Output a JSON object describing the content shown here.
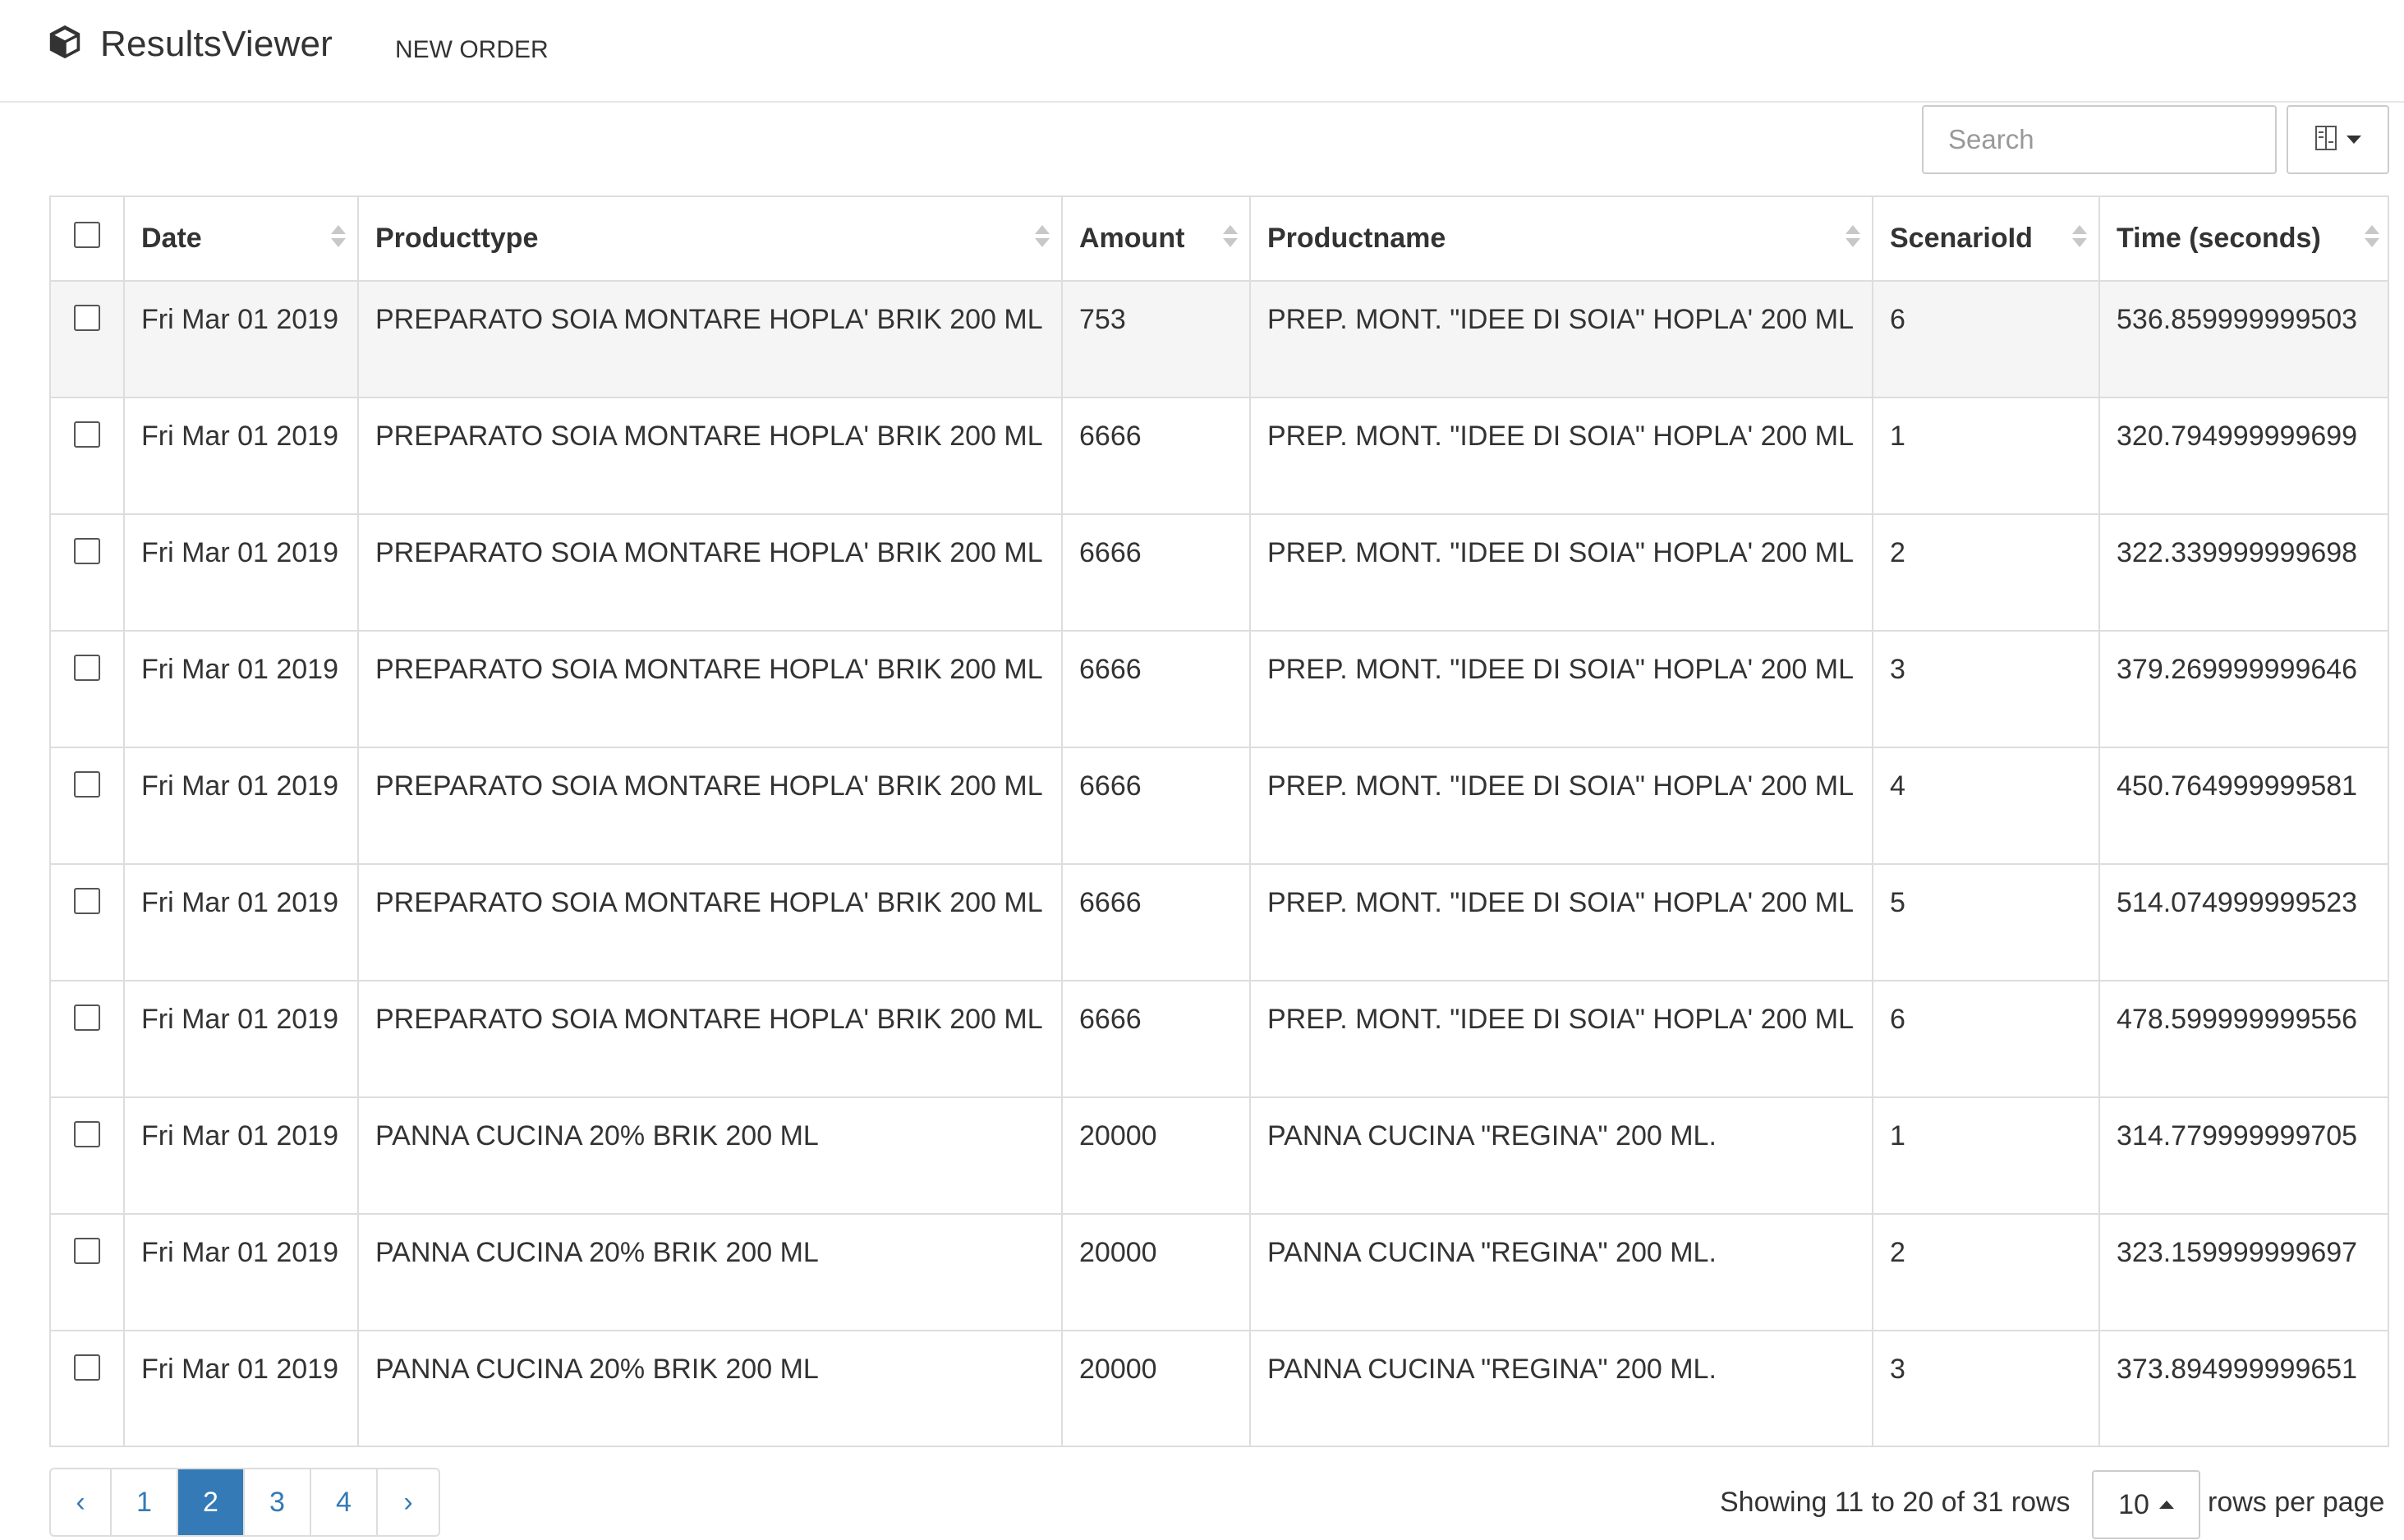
{
  "app": {
    "title": "ResultsViewer",
    "logo_icon": "cube-icon"
  },
  "nav": {
    "new_order": "NEW ORDER"
  },
  "toolbar": {
    "search_placeholder": "Search",
    "columns_icon": "columns-toggle-icon"
  },
  "table": {
    "columns": [
      "Date",
      "Producttype",
      "Amount",
      "Productname",
      "ScenarioId",
      "Time (seconds)"
    ],
    "rows": [
      {
        "date": "Fri Mar 01 2019",
        "producttype": "PREPARATO SOIA MONTARE HOPLA' BRIK 200 ML",
        "amount": "753",
        "productname": "PREP. MONT. \"IDEE DI SOIA\" HOPLA' 200 ML",
        "scenario": "6",
        "time": "536.859999999503"
      },
      {
        "date": "Fri Mar 01 2019",
        "producttype": "PREPARATO SOIA MONTARE HOPLA' BRIK 200 ML",
        "amount": "6666",
        "productname": "PREP. MONT. \"IDEE DI SOIA\" HOPLA' 200 ML",
        "scenario": "1",
        "time": "320.794999999699"
      },
      {
        "date": "Fri Mar 01 2019",
        "producttype": "PREPARATO SOIA MONTARE HOPLA' BRIK 200 ML",
        "amount": "6666",
        "productname": "PREP. MONT. \"IDEE DI SOIA\" HOPLA' 200 ML",
        "scenario": "2",
        "time": "322.339999999698"
      },
      {
        "date": "Fri Mar 01 2019",
        "producttype": "PREPARATO SOIA MONTARE HOPLA' BRIK 200 ML",
        "amount": "6666",
        "productname": "PREP. MONT. \"IDEE DI SOIA\" HOPLA' 200 ML",
        "scenario": "3",
        "time": "379.269999999646"
      },
      {
        "date": "Fri Mar 01 2019",
        "producttype": "PREPARATO SOIA MONTARE HOPLA' BRIK 200 ML",
        "amount": "6666",
        "productname": "PREP. MONT. \"IDEE DI SOIA\" HOPLA' 200 ML",
        "scenario": "4",
        "time": "450.764999999581"
      },
      {
        "date": "Fri Mar 01 2019",
        "producttype": "PREPARATO SOIA MONTARE HOPLA' BRIK 200 ML",
        "amount": "6666",
        "productname": "PREP. MONT. \"IDEE DI SOIA\" HOPLA' 200 ML",
        "scenario": "5",
        "time": "514.074999999523"
      },
      {
        "date": "Fri Mar 01 2019",
        "producttype": "PREPARATO SOIA MONTARE HOPLA' BRIK 200 ML",
        "amount": "6666",
        "productname": "PREP. MONT. \"IDEE DI SOIA\" HOPLA' 200 ML",
        "scenario": "6",
        "time": "478.599999999556"
      },
      {
        "date": "Fri Mar 01 2019",
        "producttype": "PANNA CUCINA 20% BRIK 200 ML",
        "amount": "20000",
        "productname": "PANNA CUCINA \"REGINA\" 200 ML.",
        "scenario": "1",
        "time": "314.779999999705"
      },
      {
        "date": "Fri Mar 01 2019",
        "producttype": "PANNA CUCINA 20% BRIK 200 ML",
        "amount": "20000",
        "productname": "PANNA CUCINA \"REGINA\" 200 ML.",
        "scenario": "2",
        "time": "323.159999999697"
      },
      {
        "date": "Fri Mar 01 2019",
        "producttype": "PANNA CUCINA 20% BRIK 200 ML",
        "amount": "20000",
        "productname": "PANNA CUCINA \"REGINA\" 200 ML.",
        "scenario": "3",
        "time": "373.894999999651"
      }
    ]
  },
  "pagination": {
    "prev": "‹",
    "pages": [
      "1",
      "2",
      "3",
      "4"
    ],
    "active_page": "2",
    "next": "›",
    "info": "Showing 11 to 20 of 31 rows",
    "page_size": "10",
    "rows_per_page": "rows per page"
  },
  "colors": {
    "accent": "#337ab7",
    "border": "#dddddd",
    "highlight_row": "#f5f5f5"
  }
}
